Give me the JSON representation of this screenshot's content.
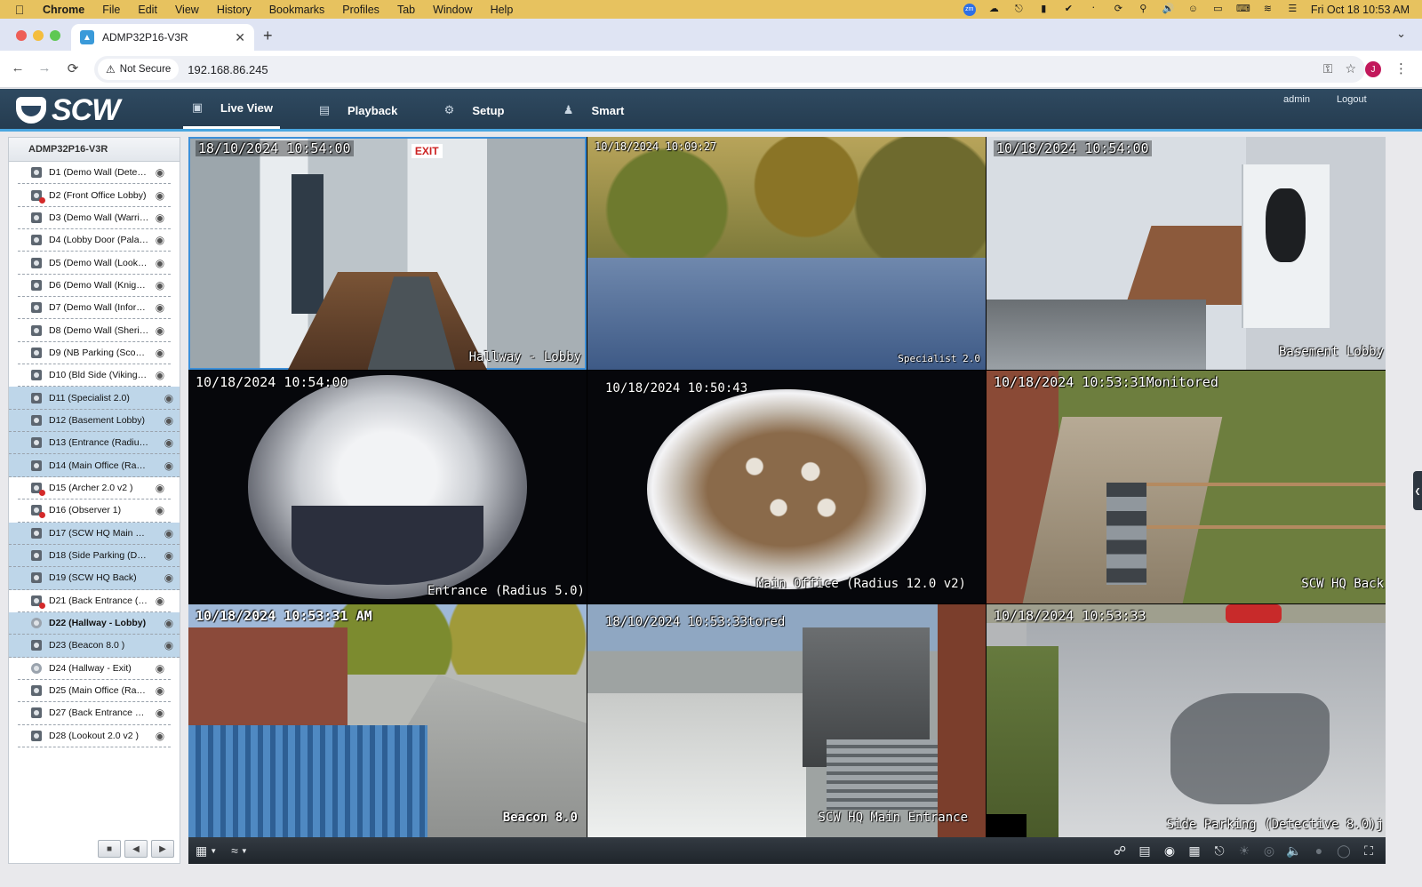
{
  "mac_menu": {
    "app": "Chrome",
    "items": [
      "File",
      "Edit",
      "View",
      "History",
      "Bookmarks",
      "Profiles",
      "Tab",
      "Window",
      "Help"
    ],
    "clock": "Fri Oct 18  10:53 AM"
  },
  "browser": {
    "tab_title": "ADMP32P16-V3R",
    "security_label": "Not Secure",
    "url": "192.168.86.245",
    "profile_initial": "J"
  },
  "header": {
    "logo_text": "SCW",
    "nav": [
      {
        "label": "Live View",
        "icon": "monitor-icon"
      },
      {
        "label": "Playback",
        "icon": "film-icon"
      },
      {
        "label": "Setup",
        "icon": "gear-icon"
      },
      {
        "label": "Smart",
        "icon": "person-icon"
      }
    ],
    "user": "admin",
    "logout": "Logout"
  },
  "sidebar": {
    "device_name": "ADMP32P16-V3R",
    "cameras": [
      {
        "label": "D1 (Demo Wall (Dete…"
      },
      {
        "label": "D2 (Front Office Lobby)"
      },
      {
        "label": "D3 (Demo Wall (Warri…"
      },
      {
        "label": "D4 (Lobby Door (Pala…"
      },
      {
        "label": "D5 (Demo Wall (Look…"
      },
      {
        "label": "D6 (Demo Wall (Knig…"
      },
      {
        "label": "D7 (Demo Wall (Infor…"
      },
      {
        "label": "D8 (Demo Wall (Sheri…"
      },
      {
        "label": "D9 (NB Parking (Sco…"
      },
      {
        "label": "D10 (Bld Side (Viking …"
      },
      {
        "label": "D11 (Specialist 2.0)"
      },
      {
        "label": "D12 (Basement Lobby)"
      },
      {
        "label": "D13 (Entrance (Radiu…"
      },
      {
        "label": "D14 (Main Office (Ra…"
      },
      {
        "label": "D15 (Archer 2.0 v2 )"
      },
      {
        "label": "D16 (Observer 1)"
      },
      {
        "label": "D17 (SCW HQ Main …"
      },
      {
        "label": "D18 (Side Parking (D…"
      },
      {
        "label": "D19 (SCW HQ Back)"
      },
      {
        "label": "D21 (Back Entrance (…"
      },
      {
        "label": "D22 (Hallway - Lobby)"
      },
      {
        "label": "D23 (Beacon 8.0 )"
      },
      {
        "label": "D24 (Hallway - Exit)"
      },
      {
        "label": "D25 (Main Office (Ra…"
      },
      {
        "label": "D27 (Back Entrance …"
      },
      {
        "label": "D28 (Lookout 2.0 v2 )"
      }
    ]
  },
  "tiles": [
    {
      "timestamp": "18/10/2024 10:54:00",
      "name": "Hallway - Lobby",
      "sign": "EXIT"
    },
    {
      "timestamp": "10/18/2024 10:09:27",
      "name": "Specialist 2.0"
    },
    {
      "timestamp": "10/18/2024 10:54:00",
      "name": "Basement Lobby"
    },
    {
      "timestamp": "10/18/2024 10:54:00",
      "name": "Entrance (Radius 5.0)"
    },
    {
      "timestamp": "10/18/2024 10:50:43",
      "name": "Main Office (Radius 12.0 v2)"
    },
    {
      "timestamp": "10/18/2024 10:53:31Monitored",
      "name": "SCW HQ Back"
    },
    {
      "timestamp": "10/18/2024 10:53:31 AM",
      "name": "Beacon 8.0"
    },
    {
      "timestamp": "18/10/2024 10:53:33tored",
      "name": "SCW HQ Main Entrance"
    },
    {
      "timestamp": "10/18/2024 10:53:33",
      "name": "Side Parking (Detective 8.0)j"
    }
  ]
}
